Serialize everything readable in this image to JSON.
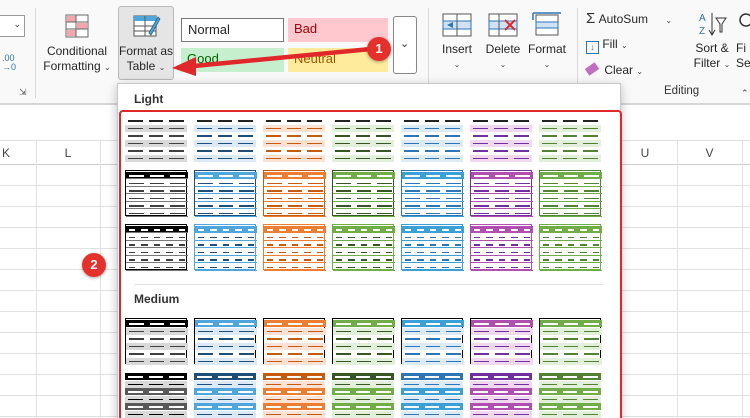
{
  "ribbon": {
    "styles_group": {
      "conditional_formatting": {
        "line1": "Conditional",
        "line2": "Formatting"
      },
      "format_as_table": {
        "line1": "Format as",
        "line2": "Table"
      },
      "cell_styles": {
        "normal": "Normal",
        "bad": "Bad",
        "good": "Good",
        "neutral": "Neutral"
      }
    },
    "cells_group": {
      "insert": "Insert",
      "delete": "Delete",
      "format": "Format"
    },
    "editing_group": {
      "autosum": "AutoSum",
      "fill": "Fill",
      "clear": "Clear",
      "sort_filter": {
        "line1": "Sort &",
        "line2": "Filter"
      },
      "find_partial": {
        "line1": "Fi",
        "line2": "Se"
      },
      "label": "Editing"
    },
    "colors": {
      "normal_bg": "#ffffff",
      "bad_bg": "#ffc7ce",
      "bad_fg": "#9c0006",
      "good_bg": "#c6efce",
      "good_fg": "#006100",
      "neutral_bg": "#ffeb9c",
      "neutral_fg": "#9c5700"
    }
  },
  "sheet": {
    "columns_left": [
      "K",
      "L"
    ],
    "columns_right": [
      "U",
      "V"
    ]
  },
  "gallery": {
    "section_light": "Light",
    "section_medium": "Medium",
    "palette": [
      "#595959",
      "#4ea6dc",
      "#ed7d31",
      "#70ad47",
      "#3ba0d8",
      "#b04fb0",
      "#70ad47"
    ],
    "palette_light": [
      "#d9d9d9",
      "#dceaf7",
      "#fbe2d5",
      "#e2efda",
      "#ddebf7",
      "#f0d9f0",
      "#e2efda"
    ],
    "palette_dark": [
      "#000000",
      "#1f4e79",
      "#c55a11",
      "#375623",
      "#2e75b6",
      "#7030a0",
      "#548235"
    ]
  },
  "annotations": {
    "badge1": "1",
    "badge2": "2",
    "accent": "#e0282a"
  }
}
